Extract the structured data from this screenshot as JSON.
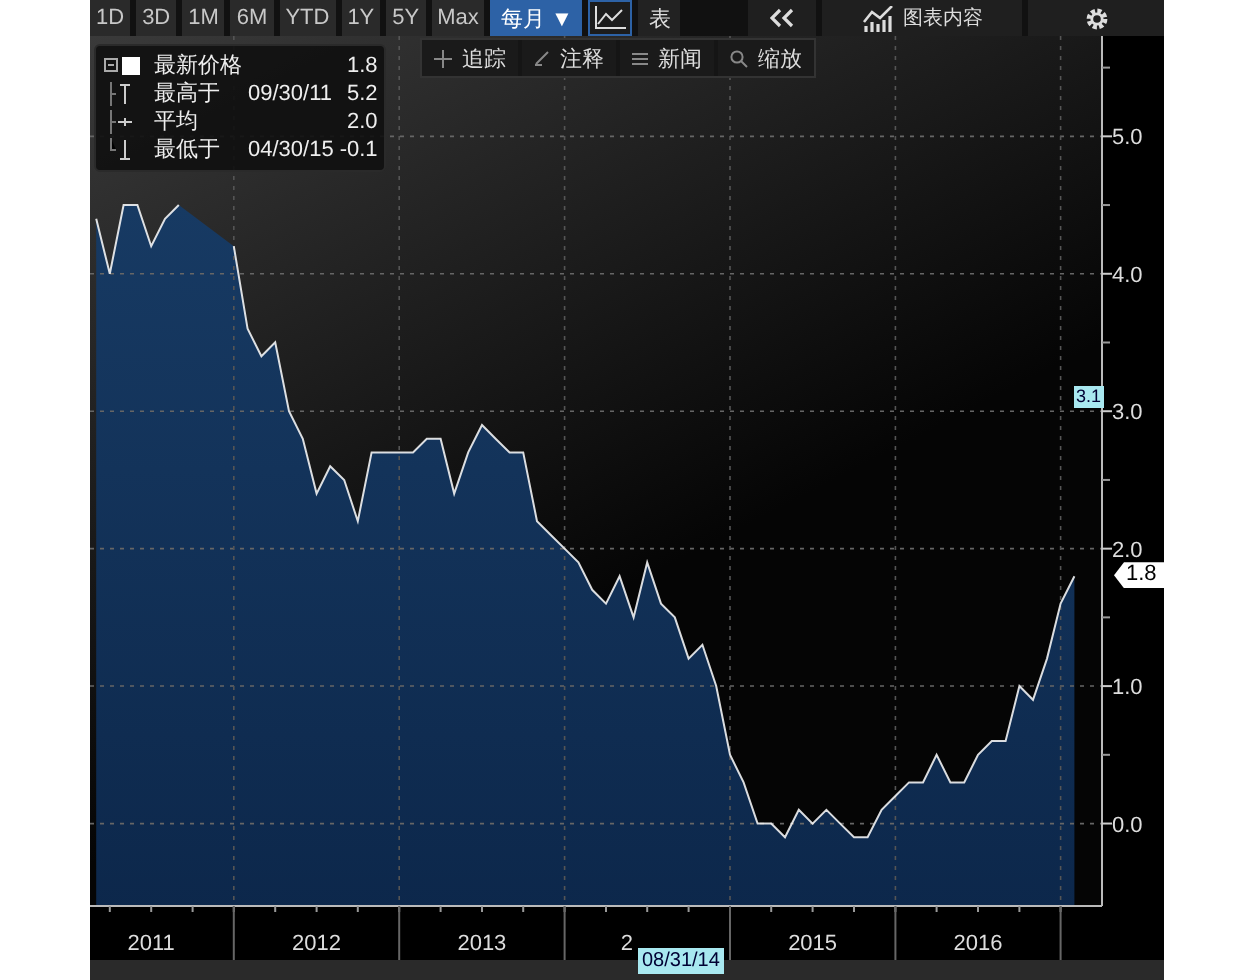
{
  "toolbar": {
    "ranges": [
      {
        "label": "1D",
        "selected": false
      },
      {
        "label": "3D",
        "selected": false
      },
      {
        "label": "1M",
        "selected": false
      },
      {
        "label": "6M",
        "selected": false
      },
      {
        "label": "YTD",
        "selected": false
      },
      {
        "label": "1Y",
        "selected": false
      },
      {
        "label": "5Y",
        "selected": false
      },
      {
        "label": "Max",
        "selected": false
      }
    ],
    "frequency": "每月 ▼",
    "line_chart_button": {
      "selected": true
    },
    "table_button": "表",
    "chart_contents": "图表内容"
  },
  "tools": [
    {
      "kind": "crosshair",
      "label": "追踪"
    },
    {
      "kind": "annotate",
      "label": "注释"
    },
    {
      "kind": "news",
      "label": "新闻"
    },
    {
      "kind": "zoom",
      "label": "缩放"
    }
  ],
  "legend": [
    {
      "kind": "last",
      "label": "最新价格",
      "value": "1.8"
    },
    {
      "kind": "high",
      "label": "最高于",
      "date": "09/30/11",
      "value": "5.2"
    },
    {
      "kind": "average",
      "label": "平均",
      "value": "2.0"
    },
    {
      "kind": "low",
      "label": "最低于",
      "date": "04/30/15",
      "value": "-0.1"
    }
  ],
  "chart_data": {
    "type": "area",
    "x": [
      2011.167,
      2011.25,
      2011.333,
      2011.417,
      2011.5,
      2011.583,
      2011.667,
      2011.75,
      2011.833,
      2011.917,
      2012.0,
      2012.083,
      2012.167,
      2012.25,
      2012.333,
      2012.417,
      2012.5,
      2012.583,
      2012.667,
      2012.75,
      2012.833,
      2012.917,
      2013.0,
      2013.083,
      2013.167,
      2013.25,
      2013.333,
      2013.417,
      2013.5,
      2013.583,
      2013.667,
      2013.75,
      2013.833,
      2013.917,
      2014.0,
      2014.083,
      2014.167,
      2014.25,
      2014.333,
      2014.417,
      2014.5,
      2014.583,
      2014.667,
      2014.75,
      2014.833,
      2014.917,
      2015.0,
      2015.083,
      2015.167,
      2015.25,
      2015.333,
      2015.417,
      2015.5,
      2015.583,
      2015.667,
      2015.75,
      2015.833,
      2015.917,
      2016.0,
      2016.083,
      2016.167,
      2016.25,
      2016.333,
      2016.417,
      2016.5,
      2016.583,
      2016.667,
      2016.75,
      2016.833,
      2016.917,
      2017.0,
      2017.083
    ],
    "series": [
      {
        "color": "#ffffff",
        "values": [
          4.4,
          4.0,
          4.5,
          4.5,
          4.2,
          4.4,
          4.5,
          null,
          null,
          null,
          4.2,
          3.6,
          3.4,
          3.5,
          3.0,
          2.8,
          2.4,
          2.6,
          2.5,
          2.2,
          2.7,
          2.7,
          2.7,
          2.7,
          2.8,
          2.8,
          2.4,
          2.7,
          2.9,
          2.8,
          2.7,
          2.7,
          2.2,
          2.1,
          2.0,
          1.9,
          1.7,
          1.6,
          1.8,
          1.5,
          1.9,
          1.6,
          1.5,
          1.2,
          1.3,
          1.0,
          0.5,
          0.3,
          0.0,
          0.0,
          -0.1,
          0.1,
          0.0,
          0.1,
          0.0,
          -0.1,
          -0.1,
          0.1,
          0.2,
          0.3,
          0.3,
          0.5,
          0.3,
          0.3,
          0.5,
          0.6,
          0.6,
          1.0,
          0.9,
          1.2,
          1.6,
          1.8
        ]
      }
    ],
    "xlim": [
      2011.13,
      2017.25
    ],
    "ylim": [
      -0.6,
      5.73
    ],
    "grid": true,
    "xticks": [
      {
        "value": 2011.5,
        "label": "2011"
      },
      {
        "value": 2012.5,
        "label": "2012"
      },
      {
        "value": 2013.5,
        "label": "2013"
      },
      {
        "value": 2015.5,
        "label": "2015"
      },
      {
        "value": 2016.5,
        "label": "2016"
      }
    ],
    "yticks": [
      {
        "value": 0,
        "label": "0.0"
      },
      {
        "value": 1,
        "label": "1.0"
      },
      {
        "value": 2,
        "label": "2.0"
      },
      {
        "value": 3,
        "label": "3.0"
      },
      {
        "value": 4,
        "label": "4.0"
      },
      {
        "value": 5,
        "label": "5.0"
      }
    ]
  },
  "cut_year_label": "2",
  "cursor_value": "3.1",
  "last_value_tag": "1.8",
  "cursor_date": "08/31/14"
}
